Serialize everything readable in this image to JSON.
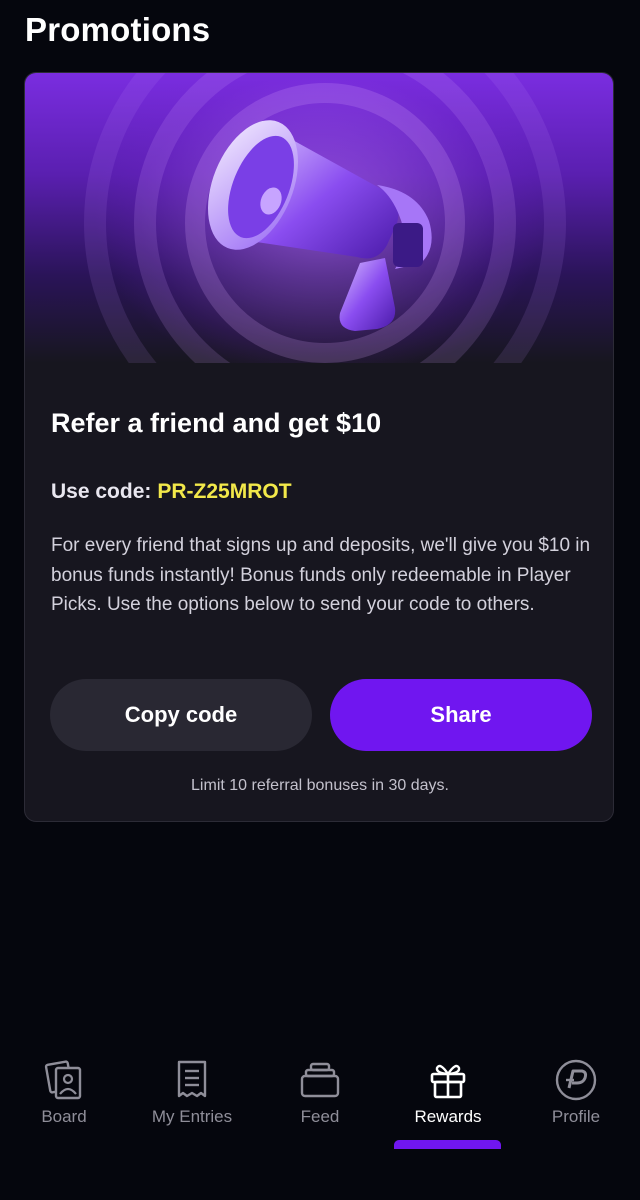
{
  "header": {
    "title": "Promotions"
  },
  "promo": {
    "title": "Refer a friend and get $10",
    "code_label": "Use code:",
    "code_value": "PR-Z25MROT",
    "description": "For every friend that signs up and deposits, we'll give you $10 in bonus funds instantly! Bonus funds only redeemable in Player Picks. Use the options below to send your code to others.",
    "copy_button": "Copy code",
    "share_button": "Share",
    "limit_note": "Limit 10 referral bonuses in 30 days.",
    "hero_icon": "megaphone-icon"
  },
  "tabs": [
    {
      "label": "Board",
      "icon": "board-icon",
      "active": false
    },
    {
      "label": "My Entries",
      "icon": "receipt-icon",
      "active": false
    },
    {
      "label": "Feed",
      "icon": "feed-icon",
      "active": false
    },
    {
      "label": "Rewards",
      "icon": "gift-icon",
      "active": true
    },
    {
      "label": "Profile",
      "icon": "profile-logo-icon",
      "active": false
    }
  ],
  "colors": {
    "background": "#05060d",
    "card": "#17161f",
    "accent": "#7016f0",
    "code_highlight": "#f2e84a",
    "inactive_tab": "#8f8e99"
  }
}
